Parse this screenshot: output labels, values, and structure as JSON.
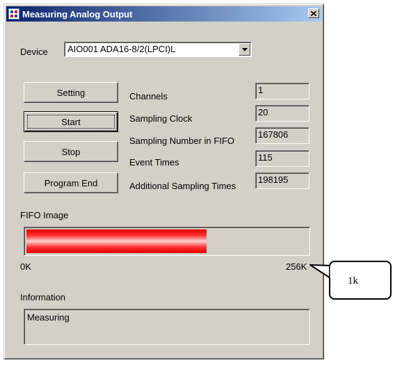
{
  "window": {
    "title": "Measuring Analog Output",
    "close_symbol": "×"
  },
  "device": {
    "label": "Device",
    "selected": "AIO001 ADA16-8/2(LPCI)L"
  },
  "buttons": {
    "setting": "Setting",
    "start": "Start",
    "stop": "Stop",
    "program_end": "Program End"
  },
  "fields": [
    {
      "label": "Channels",
      "value": "1"
    },
    {
      "label": "Sampling Clock",
      "value": "20"
    },
    {
      "label": "Sampling Number in FIFO",
      "value": "167806"
    },
    {
      "label": "Event Times",
      "value": "115"
    },
    {
      "label": "Additional Sampling Times",
      "value": "198195"
    }
  ],
  "fifo": {
    "label": "FIFO Image",
    "min_label": "0K",
    "max_label": "256K",
    "fill_fraction": 0.64,
    "fill_color": "#ff2020"
  },
  "information": {
    "label": "Information",
    "text": "Measuring"
  },
  "annotation": {
    "text": "1k"
  },
  "colors": {
    "dialog_bg": "#d4d0c8",
    "titlebar_start": "#0a246a",
    "titlebar_end": "#a6caf0"
  },
  "icons": {
    "app": "app-icon",
    "close": "close-icon",
    "dropdown": "dropdown-arrow-icon"
  }
}
